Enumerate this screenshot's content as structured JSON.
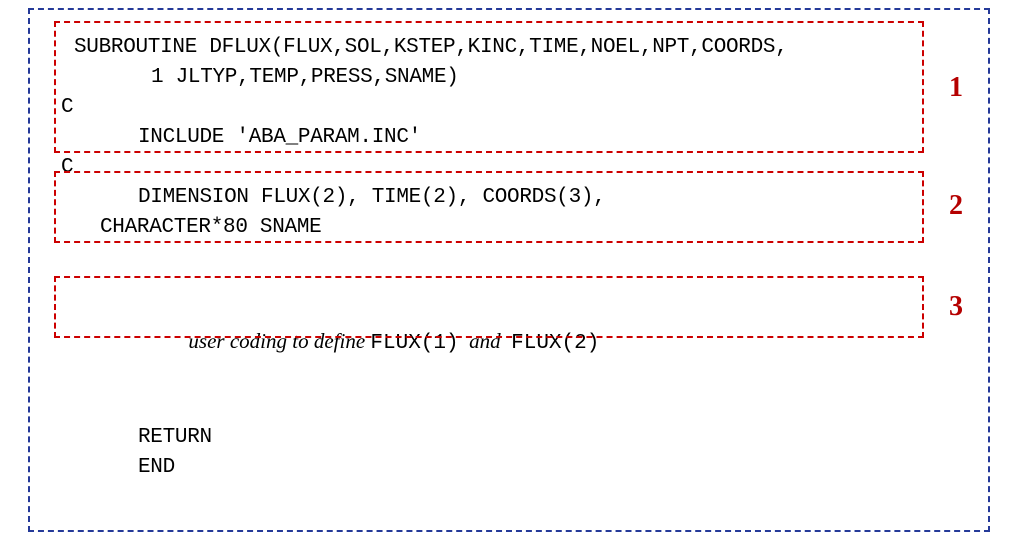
{
  "code": {
    "line1": "SUBROUTINE DFLUX(FLUX,SOL,KSTEP,KINC,TIME,NOEL,NPT,COORDS,",
    "line2": "1 JLTYP,TEMP,PRESS,SNAME)",
    "line3": "C",
    "line4": "INCLUDE 'ABA_PARAM.INC'",
    "line5": "C",
    "line6": "DIMENSION FLUX(2), TIME(2), COORDS(3),",
    "line7": "CHARACTER*80 SNAME",
    "line8_prefix": "user coding to define ",
    "line8_code1": "FLUX(1)",
    "line8_mid": "  and  ",
    "line8_code2": "FLUX(2)",
    "line9": "RETURN",
    "line10": "END"
  },
  "annotations": {
    "a1": "1",
    "a2": "2",
    "a3": "3"
  }
}
